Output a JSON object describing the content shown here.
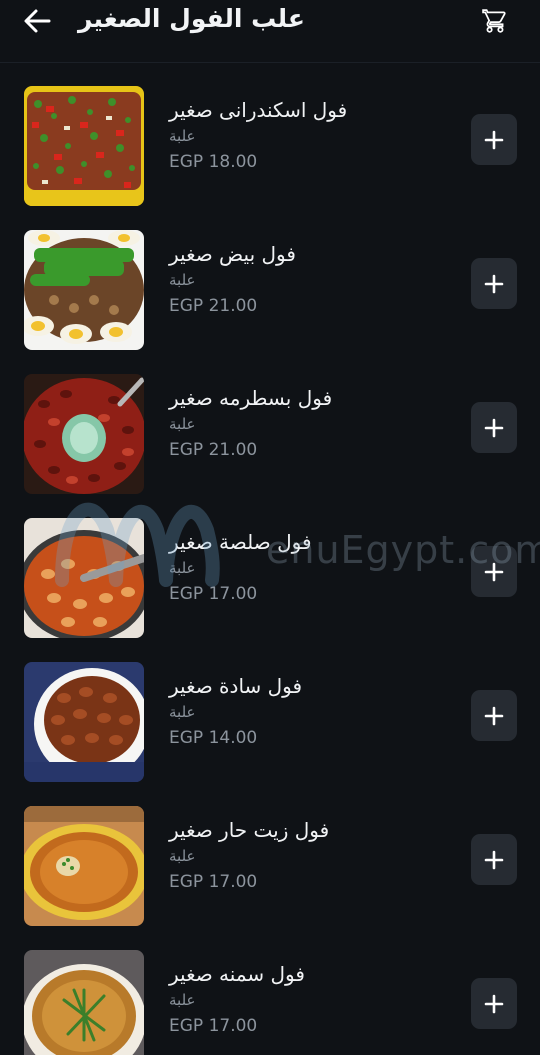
{
  "header": {
    "title": "علب الفول الصغير",
    "back_icon": "arrow-left-icon",
    "cart_icon": "cart-icon"
  },
  "items": [
    {
      "name": "فول اسكندرانى صغير",
      "unit": "علبة",
      "price": "EGP 18.00",
      "image": "foul-alexandrian-image"
    },
    {
      "name": "فول بيض صغير",
      "unit": "علبة",
      "price": "EGP 21.00",
      "image": "foul-egg-image"
    },
    {
      "name": "فول بسطرمه صغير",
      "unit": "علبة",
      "price": "EGP 21.00",
      "image": "foul-pastrami-image"
    },
    {
      "name": "فول صلصة صغير",
      "unit": "علبة",
      "price": "EGP 17.00",
      "image": "foul-sauce-image"
    },
    {
      "name": "فول سادة صغير",
      "unit": "علبة",
      "price": "EGP 14.00",
      "image": "foul-plain-image"
    },
    {
      "name": "فول زيت حار صغير",
      "unit": "علبة",
      "price": "EGP 17.00",
      "image": "foul-hot-oil-image"
    },
    {
      "name": "فول سمنه صغير",
      "unit": "علبة",
      "price": "EGP 17.00",
      "image": "foul-ghee-image"
    }
  ],
  "watermark": {
    "text": "enuEgypt.com"
  },
  "colors": {
    "background": "#0f1216",
    "button_bg": "#262b32",
    "text_primary": "#f1f3f5",
    "text_secondary": "#8a929b"
  }
}
